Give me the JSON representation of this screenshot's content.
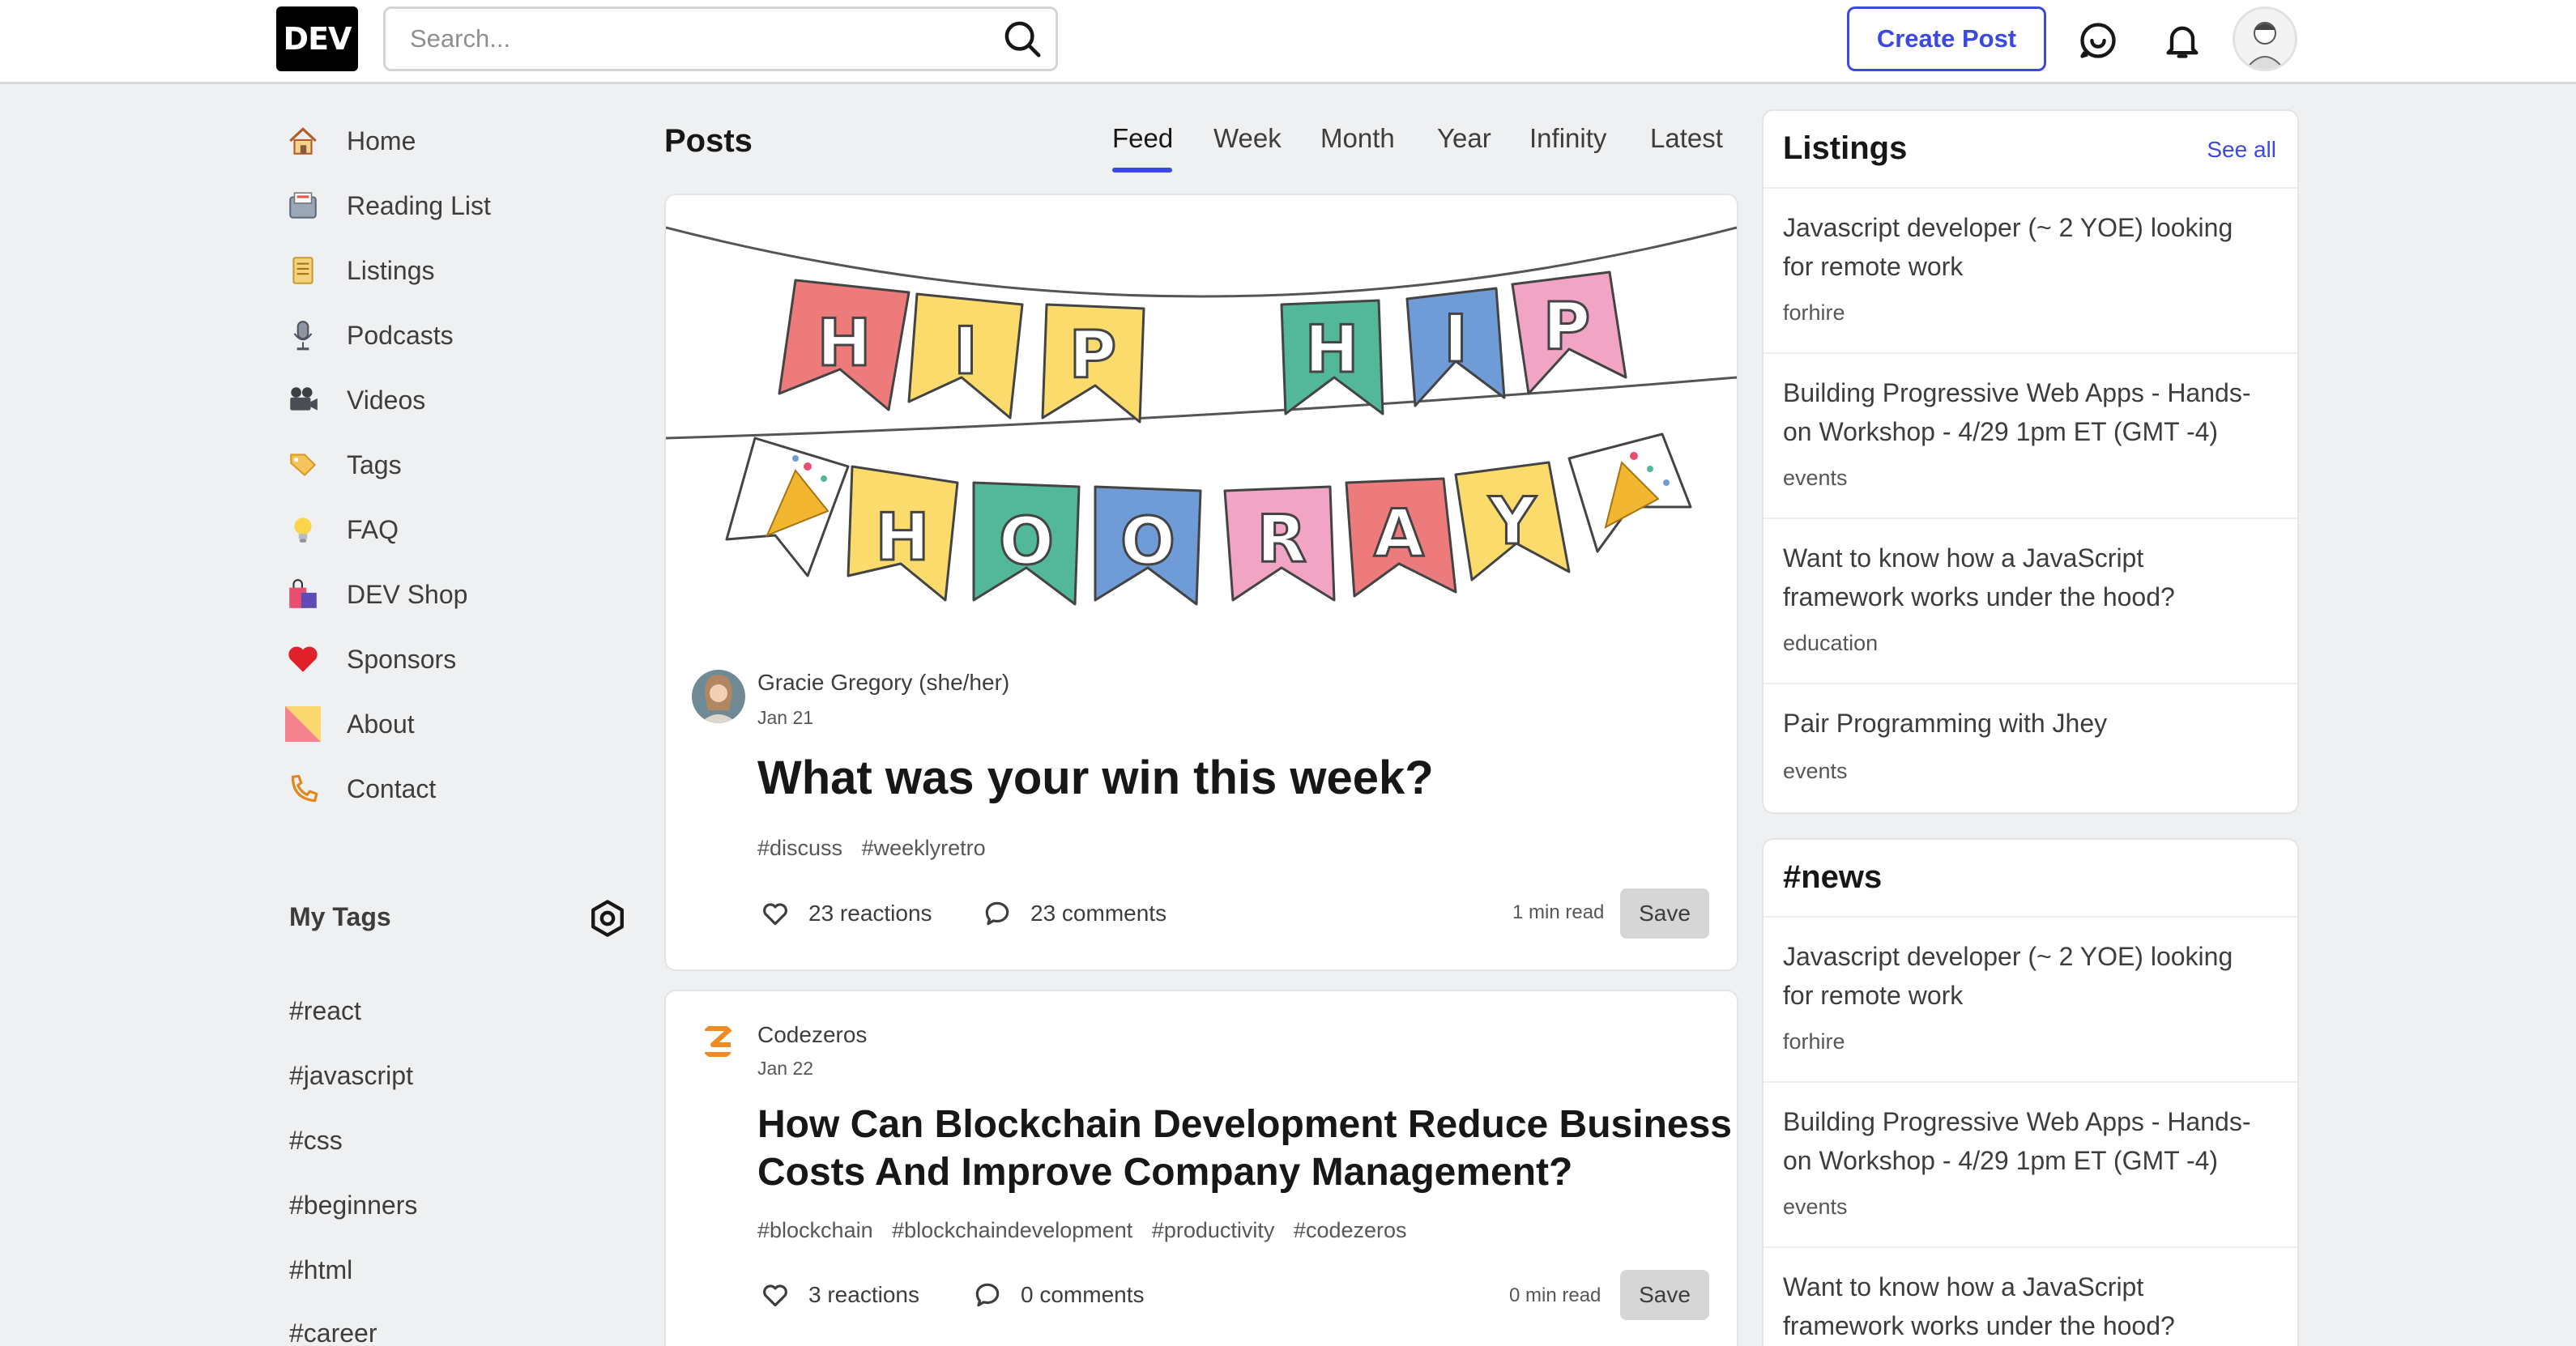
{
  "header": {
    "logo": "DEV",
    "search_placeholder": "Search...",
    "create_post": "Create Post"
  },
  "nav": [
    {
      "label": "Home",
      "icon": "house-icon"
    },
    {
      "label": "Reading List",
      "icon": "card-box-icon"
    },
    {
      "label": "Listings",
      "icon": "scroll-icon"
    },
    {
      "label": "Podcasts",
      "icon": "microphone-icon"
    },
    {
      "label": "Videos",
      "icon": "movie-camera-icon"
    },
    {
      "label": "Tags",
      "icon": "label-icon"
    },
    {
      "label": "FAQ",
      "icon": "lightbulb-icon"
    },
    {
      "label": "DEV Shop",
      "icon": "shopping-bags-icon"
    },
    {
      "label": "Sponsors",
      "icon": "heart-icon"
    },
    {
      "label": "About",
      "icon": "dev-logo-icon"
    },
    {
      "label": "Contact",
      "icon": "contact-icon"
    }
  ],
  "my_tags": {
    "title": "My Tags",
    "tags": [
      "#react",
      "#javascript",
      "#css",
      "#beginners",
      "#html",
      "#career"
    ]
  },
  "feed": {
    "title": "Posts",
    "tabs": [
      "Feed",
      "Week",
      "Month",
      "Year",
      "Infinity",
      "Latest"
    ],
    "active_tab": "Feed"
  },
  "cover": {
    "banner1": [
      "H",
      "I",
      "P",
      "H",
      "I",
      "P"
    ],
    "banner2": [
      "H",
      "O",
      "O",
      "R",
      "A",
      "Y"
    ]
  },
  "posts": [
    {
      "author": "Gracie Gregory (she/her)",
      "date": "Jan 21",
      "title": "What was your win this week?",
      "tags": [
        "#discuss",
        "#weeklyretro"
      ],
      "reactions": "23 reactions",
      "comments": "23 comments",
      "read_time": "1 min read",
      "save": "Save"
    },
    {
      "author": "Codezeros",
      "date": "Jan 22",
      "title_line1": "How Can Blockchain Development Reduce Business",
      "title_line2": "Costs And Improve Company Management?",
      "tags": [
        "#blockchain",
        "#blockchaindevelopment",
        "#productivity",
        "#codezeros"
      ],
      "reactions": "3 reactions",
      "comments": "0 comments",
      "read_time": "0 min read",
      "save": "Save"
    }
  ],
  "listings": {
    "title": "Listings",
    "see_all": "See all",
    "items": [
      {
        "line1": "Javascript developer (~ 2 YOE) looking",
        "line2": "for remote work",
        "tag": "forhire"
      },
      {
        "line1": "Building Progressive Web Apps - Hands-",
        "line2": "on Workshop - 4/29 1pm ET (GMT -4)",
        "tag": "events"
      },
      {
        "line1": "Want to know how a JavaScript",
        "line2": "framework works under the hood?",
        "tag": "education"
      },
      {
        "line1": "Pair Programming with Jhey",
        "line2": "",
        "tag": "events"
      }
    ]
  },
  "news": {
    "title": "#news",
    "items": [
      {
        "line1": "Javascript developer (~ 2 YOE) looking",
        "line2": "for remote work",
        "tag": "forhire"
      },
      {
        "line1": "Building Progressive Web Apps - Hands-",
        "line2": "on Workshop - 4/29 1pm ET (GMT -4)",
        "tag": "events"
      },
      {
        "line1": "Want to know how a JavaScript",
        "line2": "framework works under the hood?",
        "tag": ""
      }
    ]
  },
  "colors": {
    "accent": "#3b49df",
    "bg": "#eef0f1",
    "flag_red": "#ee7b7b",
    "flag_yellow": "#fbdb6c",
    "flag_green": "#52b899",
    "flag_blue": "#6f9bd6",
    "flag_pink": "#f2a4c4"
  }
}
